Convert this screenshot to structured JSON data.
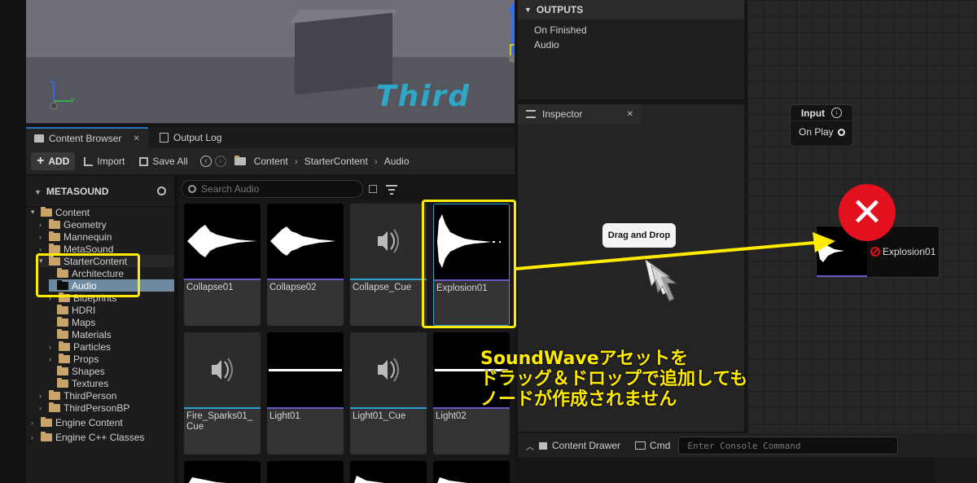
{
  "viewport": {
    "overlay_text": "Third"
  },
  "tabs": [
    {
      "label": "Content Browser",
      "close": "✕"
    },
    {
      "label": "Output Log"
    }
  ],
  "toolbar": {
    "add_label": "ADD",
    "import_label": "Import",
    "save_all_label": "Save All",
    "breadcrumb": [
      "Content",
      "StarterContent",
      "Audio"
    ]
  },
  "tree": {
    "title": "METASOUND",
    "items": [
      {
        "label": "Content"
      },
      {
        "label": "Geometry"
      },
      {
        "label": "Mannequin"
      },
      {
        "label": "MetaSound"
      },
      {
        "label": "StarterContent"
      },
      {
        "label": "Architecture"
      },
      {
        "label": "Audio"
      },
      {
        "label": "Blueprints"
      },
      {
        "label": "HDRI"
      },
      {
        "label": "Maps"
      },
      {
        "label": "Materials"
      },
      {
        "label": "Particles"
      },
      {
        "label": "Props"
      },
      {
        "label": "Shapes"
      },
      {
        "label": "Textures"
      },
      {
        "label": "ThirdPerson"
      },
      {
        "label": "ThirdPersonBP"
      },
      {
        "label": "Engine Content"
      },
      {
        "label": "Engine C++ Classes"
      }
    ]
  },
  "search": {
    "placeholder": "Search Audio"
  },
  "assets": [
    {
      "name": "Collapse01"
    },
    {
      "name": "Collapse02"
    },
    {
      "name": "Collapse_Cue"
    },
    {
      "name": "Explosion01"
    },
    {
      "name": "Fire_Sparks01_ Cue"
    },
    {
      "name": "Light01"
    },
    {
      "name": "Light01_Cue"
    },
    {
      "name": "Light02"
    }
  ],
  "outputs": {
    "title": "OUTPUTS",
    "items": [
      "On Finished",
      "Audio"
    ]
  },
  "inspector": {
    "title": "Inspector",
    "close": "✕"
  },
  "graph": {
    "input_node": {
      "title": "Input",
      "pin": "On Play"
    },
    "explosion_node": {
      "label": "Explosion01"
    }
  },
  "statusbar": {
    "content_drawer": "Content Drawer",
    "cmd": "Cmd",
    "console_placeholder": "Enter Console Command"
  },
  "annotation": {
    "tooltip": "Drag and Drop",
    "lines": [
      "SoundWaveアセットを",
      "ドラッグ＆ドロップで追加しても",
      "ノードが作成されません"
    ]
  },
  "colors": {
    "accent_blue": "#2a6fc8",
    "annotation_yellow": "#ffeb00",
    "error_red": "#e3101e",
    "wave_underline": "#6b57c9",
    "cue_underline": "#2fa0d8"
  }
}
